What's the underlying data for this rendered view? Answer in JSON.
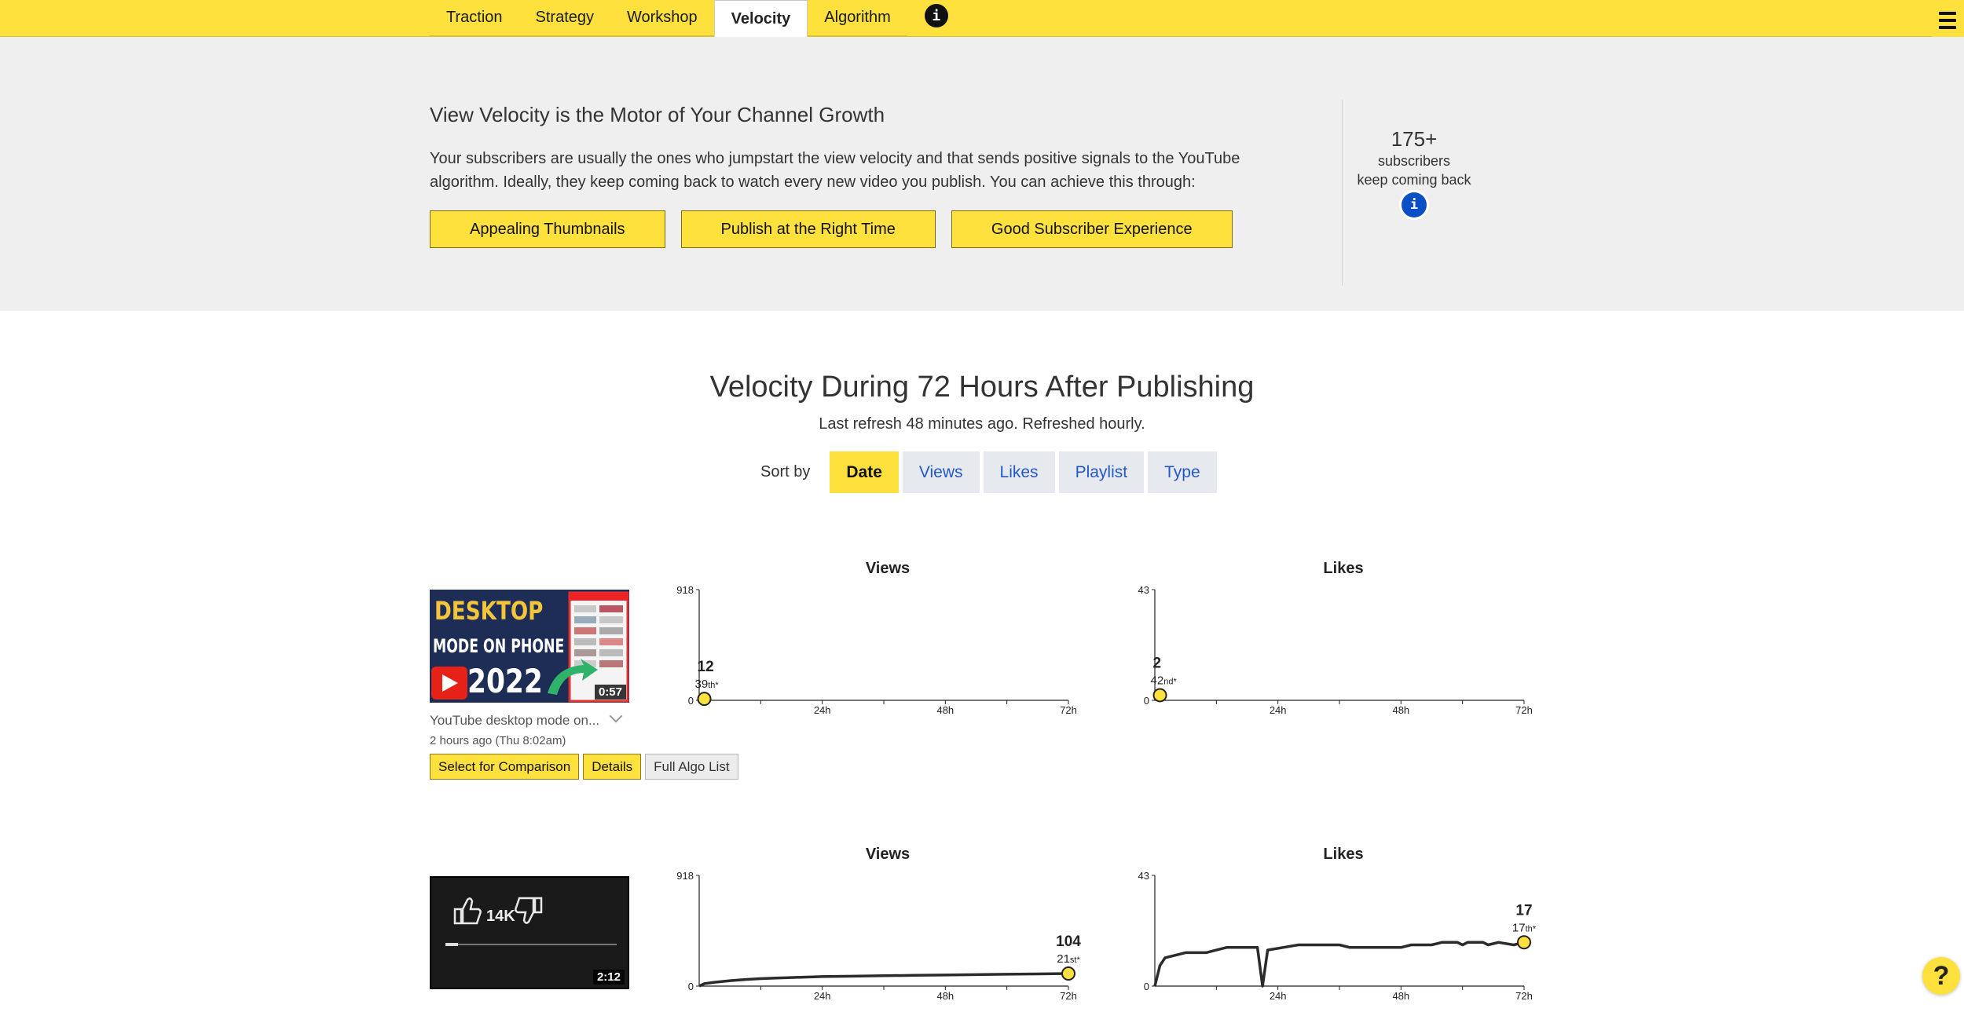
{
  "nav": {
    "tabs": [
      {
        "label": "Traction"
      },
      {
        "label": "Strategy"
      },
      {
        "label": "Workshop"
      },
      {
        "label": "Velocity",
        "active": true
      },
      {
        "label": "Algorithm"
      }
    ],
    "info_glyph": "i",
    "menu_icon": "hamburger-icon"
  },
  "hero": {
    "title": "View Velocity is the Motor of Your Channel Growth",
    "text": "Your subscribers are usually the ones who jumpstart the view velocity and that sends positive signals to the YouTube algorithm. Ideally, they keep coming back to watch every new video you publish. You can achieve this through:",
    "buttons": [
      "Appealing Thumbnails",
      "Publish at the Right Time",
      "Good Subscriber Experience"
    ],
    "stat": {
      "value": "175+",
      "line1": "subscribers",
      "line2": "keep coming back",
      "info_glyph": "i"
    }
  },
  "section": {
    "title": "Velocity During 72 Hours After Publishing",
    "refresh": "Last refresh 48 minutes ago. Refreshed hourly.",
    "sort_label": "Sort by",
    "sort_options": [
      {
        "label": "Date",
        "active": true
      },
      {
        "label": "Views"
      },
      {
        "label": "Likes"
      },
      {
        "label": "Playlist"
      },
      {
        "label": "Type"
      }
    ]
  },
  "videos": [
    {
      "title": "YouTube desktop mode on...",
      "expand_icon": "chevron-down-icon",
      "date": "2 hours ago (Thu 8:02am)",
      "duration": "0:57",
      "thumb_text": {
        "line1": "DESKTOP",
        "line2": "MODE ON PHONE",
        "line3": "2022"
      },
      "actions": [
        "Select for Comparison",
        "Details",
        "Full Algo List"
      ]
    },
    {
      "duration": "2:12",
      "thumb_text": {
        "likes": "14K"
      }
    }
  ],
  "colors": {
    "accent": "#ffe13d",
    "link": "#2458c9",
    "info_blue": "#0b4fc7"
  },
  "chart_data": [
    {
      "type": "line",
      "title": "Views",
      "ylim": [
        0,
        918
      ],
      "y_ticks": [
        "918",
        "0"
      ],
      "x_ticks": [
        "24h",
        "48h",
        "72h"
      ],
      "xlim": [
        0,
        72
      ],
      "series": [
        {
          "values": [
            [
              1,
              12
            ]
          ]
        }
      ],
      "end_label": "12",
      "end_rank": "39",
      "end_rank_suffix": "th*"
    },
    {
      "type": "line",
      "title": "Likes",
      "ylim": [
        0,
        43
      ],
      "y_ticks": [
        "43",
        "0"
      ],
      "x_ticks": [
        "24h",
        "48h",
        "72h"
      ],
      "xlim": [
        0,
        72
      ],
      "series": [
        {
          "values": [
            [
              1,
              2
            ]
          ]
        }
      ],
      "end_label": "2",
      "end_rank": "42",
      "end_rank_suffix": "nd*"
    },
    {
      "type": "line",
      "title": "Views",
      "ylim": [
        0,
        918
      ],
      "y_ticks": [
        "918",
        "0"
      ],
      "x_ticks": [
        "24h",
        "48h",
        "72h"
      ],
      "xlim": [
        0,
        72
      ],
      "series": [
        {
          "values": [
            [
              0,
              0
            ],
            [
              1,
              20
            ],
            [
              3,
              32
            ],
            [
              6,
              45
            ],
            [
              9,
              55
            ],
            [
              12,
              62
            ],
            [
              15,
              67
            ],
            [
              18,
              71
            ],
            [
              21,
              75
            ],
            [
              24,
              79
            ],
            [
              30,
              82
            ],
            [
              36,
              86
            ],
            [
              42,
              89
            ],
            [
              48,
              92
            ],
            [
              54,
              95
            ],
            [
              60,
              98
            ],
            [
              66,
              101
            ],
            [
              72,
              104
            ]
          ]
        }
      ],
      "end_label": "104",
      "end_rank": "21",
      "end_rank_suffix": "st*"
    },
    {
      "type": "line",
      "title": "Likes",
      "ylim": [
        0,
        43
      ],
      "y_ticks": [
        "43",
        "0"
      ],
      "x_ticks": [
        "24h",
        "48h",
        "72h"
      ],
      "xlim": [
        0,
        72
      ],
      "series": [
        {
          "values": [
            [
              0,
              0
            ],
            [
              1,
              8
            ],
            [
              2,
              11
            ],
            [
              4,
              12
            ],
            [
              6,
              13
            ],
            [
              10,
              13
            ],
            [
              12,
              14
            ],
            [
              14,
              15
            ],
            [
              20,
              15
            ],
            [
              21,
              0
            ],
            [
              22,
              14
            ],
            [
              25,
              15
            ],
            [
              28,
              16
            ],
            [
              36,
              16
            ],
            [
              38,
              15
            ],
            [
              48,
              15
            ],
            [
              50,
              16
            ],
            [
              54,
              16
            ],
            [
              56,
              17
            ],
            [
              59,
              17
            ],
            [
              60,
              16
            ],
            [
              61,
              17
            ],
            [
              64,
              17
            ],
            [
              65,
              16
            ],
            [
              67,
              17
            ],
            [
              70,
              16
            ],
            [
              72,
              17
            ]
          ]
        }
      ],
      "end_label": "17",
      "end_rank": "17",
      "end_rank_suffix": "th*"
    }
  ]
}
